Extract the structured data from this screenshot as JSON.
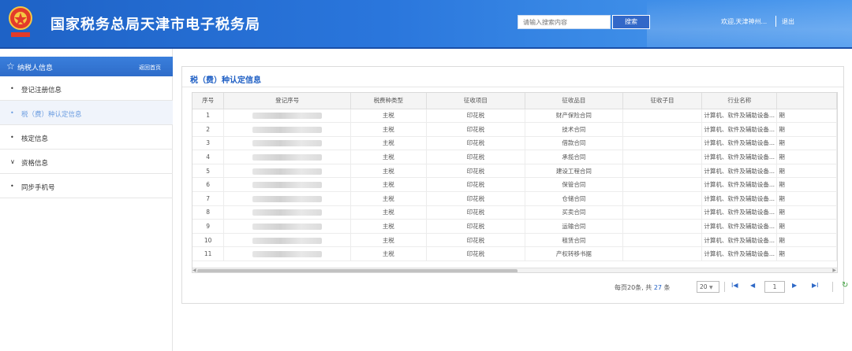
{
  "header": {
    "title": "国家税务总局天津市电子税务局",
    "search_placeholder": "请输入搜索内容",
    "search_button": "搜索",
    "welcome": "欢迎,天津神州...",
    "logout": "退出"
  },
  "sidebar": {
    "heading": "纳税人信息",
    "home_link": "返回首页",
    "items": [
      {
        "label": "登记注册信息",
        "bullet": "•"
      },
      {
        "label": "税（费）种认定信息",
        "bullet": "•"
      },
      {
        "label": "核定信息",
        "bullet": "•"
      },
      {
        "label": "资格信息",
        "bullet": "∨"
      },
      {
        "label": "同步手机号",
        "bullet": "•"
      }
    ]
  },
  "panel": {
    "title": "税（费）种认定信息",
    "columns": [
      "序号",
      "登记序号",
      "税费种类型",
      "征收项目",
      "征收品目",
      "征收子目",
      "行业名称",
      ""
    ],
    "rows": [
      {
        "no": "1",
        "type": "主税",
        "item": "印花税",
        "product": "财产保险合同",
        "sub": "",
        "industry": "计算机、软件及辅助设备...",
        "extra": "期"
      },
      {
        "no": "2",
        "type": "主税",
        "item": "印花税",
        "product": "技术合同",
        "sub": "",
        "industry": "计算机、软件及辅助设备...",
        "extra": "期"
      },
      {
        "no": "3",
        "type": "主税",
        "item": "印花税",
        "product": "借款合同",
        "sub": "",
        "industry": "计算机、软件及辅助设备...",
        "extra": "期"
      },
      {
        "no": "4",
        "type": "主税",
        "item": "印花税",
        "product": "承揽合同",
        "sub": "",
        "industry": "计算机、软件及辅助设备...",
        "extra": "期"
      },
      {
        "no": "5",
        "type": "主税",
        "item": "印花税",
        "product": "建设工程合同",
        "sub": "",
        "industry": "计算机、软件及辅助设备...",
        "extra": "期"
      },
      {
        "no": "6",
        "type": "主税",
        "item": "印花税",
        "product": "保管合同",
        "sub": "",
        "industry": "计算机、软件及辅助设备...",
        "extra": "期"
      },
      {
        "no": "7",
        "type": "主税",
        "item": "印花税",
        "product": "仓储合同",
        "sub": "",
        "industry": "计算机、软件及辅助设备...",
        "extra": "期"
      },
      {
        "no": "8",
        "type": "主税",
        "item": "印花税",
        "product": "买卖合同",
        "sub": "",
        "industry": "计算机、软件及辅助设备...",
        "extra": "期"
      },
      {
        "no": "9",
        "type": "主税",
        "item": "印花税",
        "product": "运输合同",
        "sub": "",
        "industry": "计算机、软件及辅助设备...",
        "extra": "期"
      },
      {
        "no": "10",
        "type": "主税",
        "item": "印花税",
        "product": "租赁合同",
        "sub": "",
        "industry": "计算机、软件及辅助设备...",
        "extra": "期"
      },
      {
        "no": "11",
        "type": "主税",
        "item": "印花税",
        "product": "产权转移书据",
        "sub": "",
        "industry": "计算机、软件及辅助设备...",
        "extra": "期"
      }
    ],
    "horizontal_scroll_fraction": 0.5
  },
  "pager": {
    "summary_prefix": "每页20条, 共",
    "total": "27",
    "summary_suffix": "条",
    "page_size": "20",
    "page_size_arrow": "▼",
    "first": "I◀",
    "prev": "◀",
    "current_page": "1",
    "next": "▶",
    "last": "▶I",
    "refresh": "↻"
  },
  "colors": {
    "brand": "#2a76dc",
    "title": "#1f5fc4",
    "active_nav": "#6a9ce0"
  }
}
